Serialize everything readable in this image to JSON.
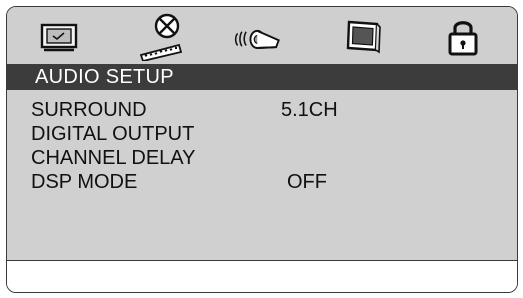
{
  "icon_bar": {
    "icons": [
      {
        "name": "general-setup-icon"
      },
      {
        "name": "video-setup-icon"
      },
      {
        "name": "audio-setup-icon",
        "active": true
      },
      {
        "name": "picture-setup-icon"
      },
      {
        "name": "lock-icon"
      }
    ]
  },
  "section": {
    "title": "AUDIO SETUP"
  },
  "settings": [
    {
      "label": "SURROUND",
      "value": "5.1CH"
    },
    {
      "label": "DIGITAL OUTPUT",
      "value": ""
    },
    {
      "label": "CHANNEL DELAY",
      "value": ""
    },
    {
      "label": "DSP MODE",
      "value": "OFF"
    }
  ],
  "colors": {
    "icon_bar_bg": "#cfcfcf",
    "title_bar_bg": "#3c3c3c",
    "panel_bg": "#d0d0d0",
    "text": "#111111"
  }
}
